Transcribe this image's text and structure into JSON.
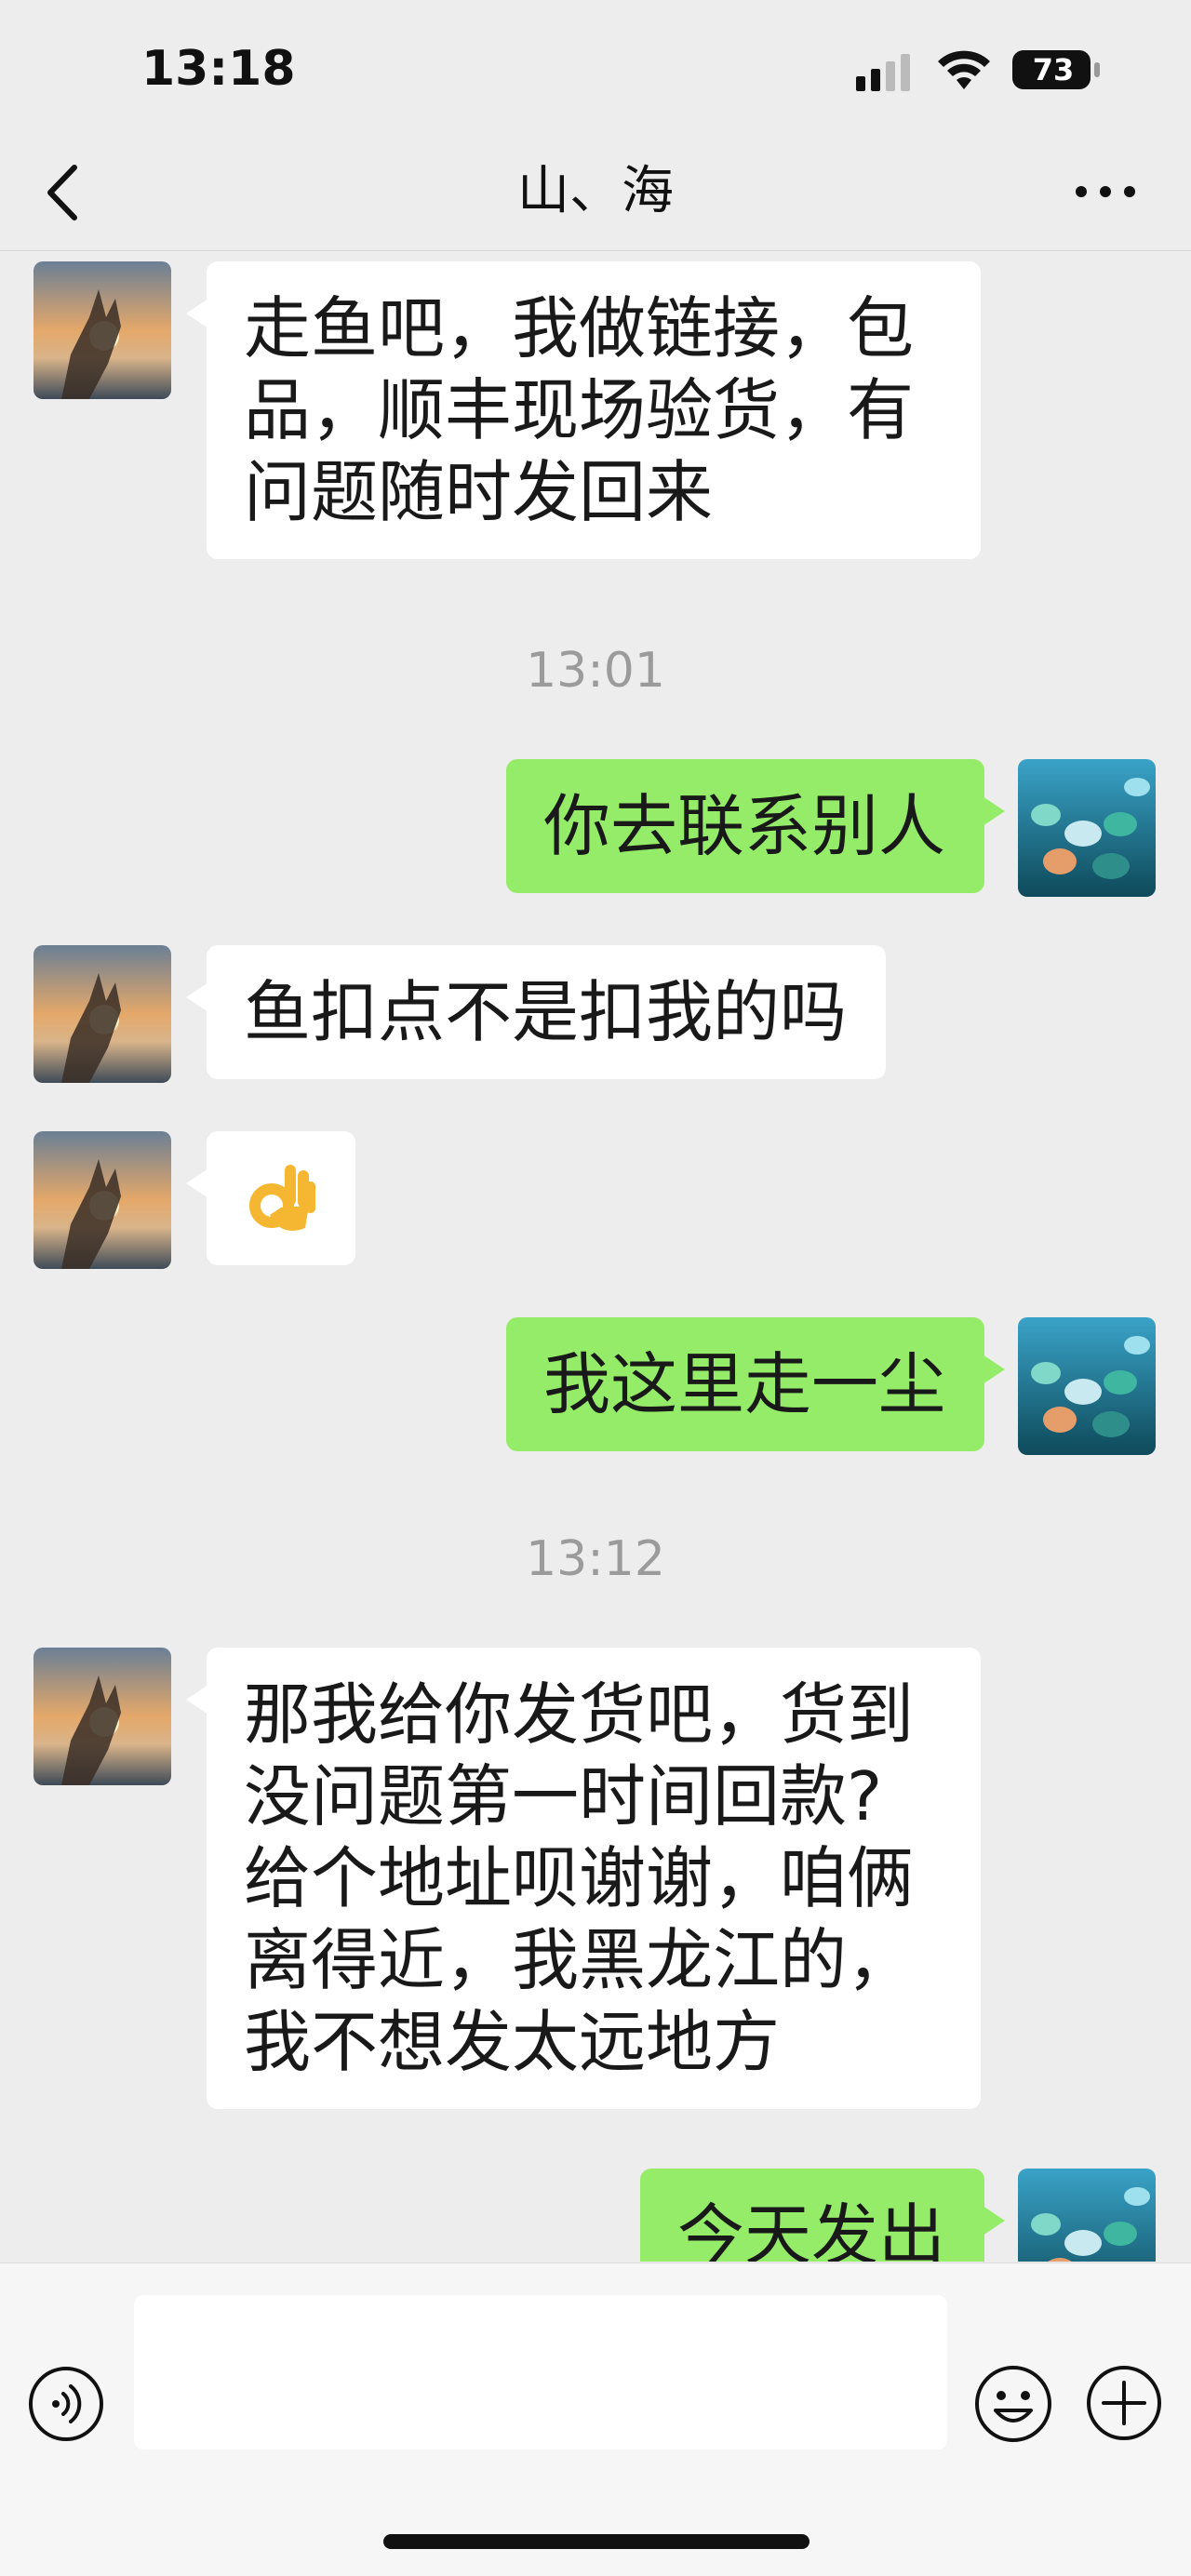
{
  "status_bar": {
    "time": "13:18",
    "battery": "73",
    "icons": [
      "signal-icon",
      "wifi-icon",
      "battery-icon"
    ]
  },
  "nav": {
    "title": "山、海",
    "back_icon": "chevron-left-icon",
    "more_icon": "more-dots-icon"
  },
  "messages": [
    {
      "sender": "contact",
      "text_lines": [
        "走鱼吧，我做链接，包",
        "品，顺丰现场验货，有",
        "问题随时发回来"
      ]
    },
    {
      "type": "timestamp",
      "text": "13:01"
    },
    {
      "sender": "me",
      "text_lines": [
        "你去联系别人"
      ]
    },
    {
      "sender": "contact",
      "text_lines": [
        "鱼扣点不是扣我的吗"
      ]
    },
    {
      "sender": "contact",
      "emoji": "ok-hand-emoji"
    },
    {
      "sender": "me",
      "text_lines": [
        "我这里走一尘"
      ]
    },
    {
      "type": "timestamp",
      "text": "13:12"
    },
    {
      "sender": "contact",
      "text_lines": [
        "那我给你发货吧，货到",
        "没问题第一时间回款?",
        "给个地址呗谢谢，咱俩",
        "离得近，我黑龙江的，",
        "我不想发太远地方"
      ]
    },
    {
      "sender": "me",
      "text_lines": [
        "今天发出"
      ]
    }
  ],
  "input_bar": {
    "placeholder": "",
    "icons": [
      "voice-icon",
      "emoji-icon",
      "plus-icon"
    ]
  },
  "colors": {
    "background": "#ededed",
    "bubble_out": "#95ec69",
    "bubble_in": "#ffffff",
    "timestamp": "#9b9b9b"
  }
}
